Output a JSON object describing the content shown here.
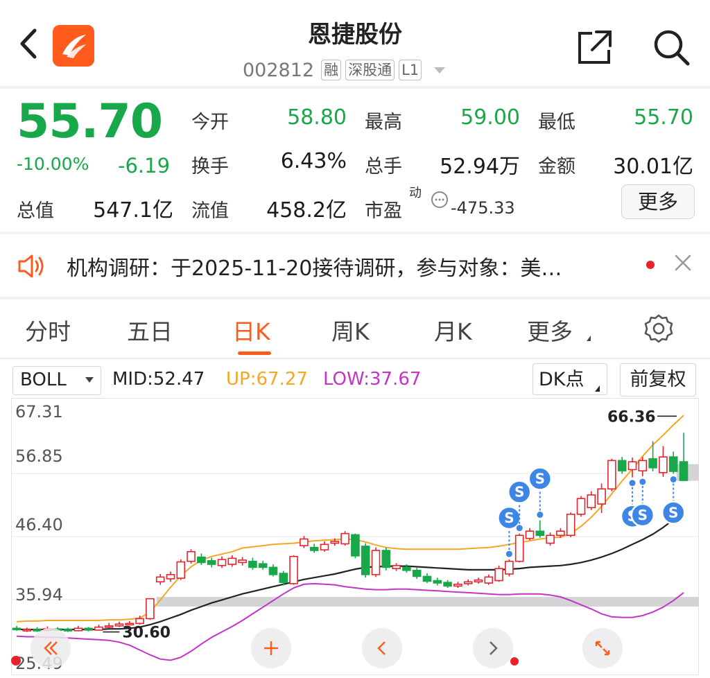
{
  "header": {
    "title": "恩捷股份",
    "code": "002812",
    "tags": [
      "融",
      "深股通",
      "L1"
    ]
  },
  "quote": {
    "price": "55.70",
    "change_pct": "-10.00%",
    "change_amt": "-6.19",
    "stats": [
      {
        "label": "今开",
        "value": "58.80",
        "green": true
      },
      {
        "label": "最高",
        "value": "59.00",
        "green": true
      },
      {
        "label": "最低",
        "value": "55.70",
        "green": true
      },
      {
        "label": "换手",
        "value": "6.43%",
        "green": false
      },
      {
        "label": "总手",
        "value": "52.94万",
        "green": false
      },
      {
        "label": "金额",
        "value": "30.01亿",
        "green": false
      },
      {
        "label": "总值",
        "value": "547.1亿",
        "green": false
      },
      {
        "label": "流值",
        "value": "458.2亿",
        "green": false
      }
    ],
    "pe_label": "市盈",
    "pe_sup": "动",
    "pe_value": "-475.33",
    "more_label": "更多"
  },
  "news": {
    "text": "机构调研：于2025-11-20接待调研，参与对象：美…"
  },
  "tabs": [
    {
      "label": "分时",
      "active": false
    },
    {
      "label": "五日",
      "active": false
    },
    {
      "label": "日K",
      "active": true
    },
    {
      "label": "周K",
      "active": false
    },
    {
      "label": "月K",
      "active": false
    },
    {
      "label": "更多",
      "active": false
    }
  ],
  "indicator": {
    "selected": "BOLL",
    "mid": "MID:52.47",
    "up": "UP:67.27",
    "low": "LOW:37.67",
    "dk_label": "DK点",
    "fq_label": "前复权"
  },
  "colors": {
    "accent": "#ff5b1c",
    "down_green": "#18a84a",
    "up_red": "#e8222b",
    "boll_up": "#f5a623",
    "boll_low": "#c433c8",
    "boll_mid": "#222222",
    "signal_blue": "#3d86e6"
  },
  "chart_data": {
    "type": "candlestick",
    "y_ticks": [
      "67.31",
      "56.85",
      "46.40",
      "35.94",
      "25.49"
    ],
    "ylim": [
      25.49,
      67.31
    ],
    "annotations": {
      "max_label": "66.36",
      "min_label": "30.60"
    },
    "candles": [
      {
        "o": 31.2,
        "c": 31.0,
        "h": 31.6,
        "l": 30.8
      },
      {
        "o": 30.8,
        "c": 31.0,
        "h": 31.3,
        "l": 30.6
      },
      {
        "o": 31.0,
        "c": 30.9,
        "h": 31.4,
        "l": 30.6
      },
      {
        "o": 30.9,
        "c": 31.1,
        "h": 31.5,
        "l": 30.7
      },
      {
        "o": 31.1,
        "c": 31.0,
        "h": 31.4,
        "l": 30.8
      },
      {
        "o": 31.0,
        "c": 30.8,
        "h": 31.3,
        "l": 30.6
      },
      {
        "o": 30.8,
        "c": 31.2,
        "h": 31.6,
        "l": 30.7
      },
      {
        "o": 31.2,
        "c": 30.9,
        "h": 31.4,
        "l": 30.7
      },
      {
        "o": 30.9,
        "c": 31.4,
        "h": 31.8,
        "l": 30.8
      },
      {
        "o": 31.4,
        "c": 31.6,
        "h": 32.1,
        "l": 31.2
      },
      {
        "o": 31.6,
        "c": 31.9,
        "h": 32.3,
        "l": 31.4
      },
      {
        "o": 31.9,
        "c": 32.0,
        "h": 32.4,
        "l": 31.7
      },
      {
        "o": 32.0,
        "c": 32.8,
        "h": 33.3,
        "l": 31.8
      },
      {
        "o": 32.8,
        "c": 36.1,
        "h": 36.1,
        "l": 32.6
      },
      {
        "o": 38.9,
        "c": 39.7,
        "h": 40.2,
        "l": 38.4
      },
      {
        "o": 39.4,
        "c": 40.1,
        "h": 40.6,
        "l": 38.9
      },
      {
        "o": 39.5,
        "c": 42.2,
        "h": 42.6,
        "l": 39.2
      },
      {
        "o": 42.3,
        "c": 43.9,
        "h": 44.3,
        "l": 41.9
      },
      {
        "o": 43.0,
        "c": 42.1,
        "h": 43.6,
        "l": 41.7
      },
      {
        "o": 42.4,
        "c": 41.8,
        "h": 42.9,
        "l": 41.3
      },
      {
        "o": 41.6,
        "c": 42.6,
        "h": 43.1,
        "l": 41.2
      },
      {
        "o": 41.8,
        "c": 42.8,
        "h": 43.3,
        "l": 41.4
      },
      {
        "o": 42.1,
        "c": 42.5,
        "h": 43.0,
        "l": 41.6
      },
      {
        "o": 42.3,
        "c": 41.3,
        "h": 42.9,
        "l": 40.9
      },
      {
        "o": 41.9,
        "c": 41.3,
        "h": 42.4,
        "l": 40.9
      },
      {
        "o": 41.3,
        "c": 40.1,
        "h": 41.8,
        "l": 39.8
      },
      {
        "o": 40.3,
        "c": 38.8,
        "h": 40.7,
        "l": 38.3
      },
      {
        "o": 38.6,
        "c": 43.1,
        "h": 43.3,
        "l": 38.4
      },
      {
        "o": 44.9,
        "c": 46.0,
        "h": 46.5,
        "l": 44.5
      },
      {
        "o": 44.6,
        "c": 44.1,
        "h": 45.2,
        "l": 43.7
      },
      {
        "o": 44.2,
        "c": 45.1,
        "h": 45.6,
        "l": 43.9
      },
      {
        "o": 45.3,
        "c": 45.6,
        "h": 46.1,
        "l": 44.9
      },
      {
        "o": 45.2,
        "c": 46.9,
        "h": 47.3,
        "l": 44.9
      },
      {
        "o": 46.7,
        "c": 43.2,
        "h": 46.9,
        "l": 42.8
      },
      {
        "o": 44.8,
        "c": 40.1,
        "h": 45.3,
        "l": 39.6
      },
      {
        "o": 40.1,
        "c": 44.1,
        "h": 44.6,
        "l": 39.7
      },
      {
        "o": 44.1,
        "c": 41.3,
        "h": 44.6,
        "l": 40.8
      },
      {
        "o": 41.1,
        "c": 41.6,
        "h": 42.0,
        "l": 40.7
      },
      {
        "o": 41.3,
        "c": 40.8,
        "h": 41.8,
        "l": 40.4
      },
      {
        "o": 40.8,
        "c": 39.8,
        "h": 41.2,
        "l": 39.4
      },
      {
        "o": 39.8,
        "c": 39.0,
        "h": 40.3,
        "l": 38.7
      },
      {
        "o": 39.1,
        "c": 38.7,
        "h": 39.6,
        "l": 38.3
      },
      {
        "o": 38.8,
        "c": 38.2,
        "h": 39.2,
        "l": 37.9
      },
      {
        "o": 38.2,
        "c": 38.5,
        "h": 38.9,
        "l": 37.9
      },
      {
        "o": 38.6,
        "c": 38.9,
        "h": 39.3,
        "l": 38.3
      },
      {
        "o": 38.9,
        "c": 39.2,
        "h": 39.6,
        "l": 38.6
      },
      {
        "o": 38.7,
        "c": 39.7,
        "h": 40.1,
        "l": 38.4
      },
      {
        "o": 39.1,
        "c": 41.1,
        "h": 41.6,
        "l": 38.9
      },
      {
        "o": 40.2,
        "c": 42.3,
        "h": 42.6,
        "l": 39.8
      },
      {
        "o": 42.3,
        "c": 46.6,
        "h": 46.9,
        "l": 42.1
      },
      {
        "o": 46.1,
        "c": 47.3,
        "h": 47.8,
        "l": 45.8
      },
      {
        "o": 47.3,
        "c": 46.6,
        "h": 49.1,
        "l": 46.2
      },
      {
        "o": 45.3,
        "c": 46.6,
        "h": 47.1,
        "l": 44.9
      },
      {
        "o": 46.6,
        "c": 47.3,
        "h": 47.8,
        "l": 46.2
      },
      {
        "o": 46.6,
        "c": 50.1,
        "h": 50.4,
        "l": 46.3
      },
      {
        "o": 50.1,
        "c": 52.7,
        "h": 53.1,
        "l": 49.7
      },
      {
        "o": 51.2,
        "c": 53.3,
        "h": 53.9,
        "l": 50.8
      },
      {
        "o": 51.8,
        "c": 54.3,
        "h": 55.2,
        "l": 50.3
      },
      {
        "o": 54.3,
        "c": 59.0,
        "h": 59.3,
        "l": 53.9
      },
      {
        "o": 59.0,
        "c": 57.3,
        "h": 59.6,
        "l": 56.8
      },
      {
        "o": 57.5,
        "c": 58.8,
        "h": 59.5,
        "l": 56.2
      },
      {
        "o": 57.3,
        "c": 59.0,
        "h": 59.6,
        "l": 56.4
      },
      {
        "o": 59.3,
        "c": 57.8,
        "h": 62.2,
        "l": 57.2
      },
      {
        "o": 57.0,
        "c": 59.6,
        "h": 61.4,
        "l": 56.3
      },
      {
        "o": 59.6,
        "c": 57.2,
        "h": 60.5,
        "l": 56.8
      },
      {
        "o": 58.8,
        "c": 55.7,
        "h": 63.6,
        "l": 55.7
      }
    ],
    "mid_line": [
      31.0,
      31.0,
      31.0,
      31.0,
      31.0,
      31.0,
      31.0,
      31.0,
      31.0,
      31.1,
      31.1,
      31.2,
      31.4,
      31.8,
      32.3,
      32.9,
      33.5,
      34.2,
      34.8,
      35.4,
      35.9,
      36.4,
      36.9,
      37.3,
      37.7,
      38.1,
      38.5,
      38.9,
      39.3,
      39.6,
      39.9,
      40.2,
      40.6,
      41.0,
      41.3,
      41.4,
      41.5,
      41.5,
      41.5,
      41.4,
      41.3,
      41.2,
      41.1,
      41.0,
      40.9,
      40.9,
      40.9,
      40.9,
      41.0,
      41.1,
      41.3,
      41.4,
      41.5,
      41.6,
      41.8,
      42.1,
      42.5,
      43.0,
      43.6,
      44.3,
      45.1,
      45.9,
      46.8,
      47.9,
      49.2,
      50.3
    ],
    "upper_line": [
      32.3,
      32.4,
      32.4,
      32.5,
      32.5,
      32.5,
      32.5,
      32.5,
      32.5,
      32.6,
      32.6,
      32.7,
      32.9,
      33.9,
      35.9,
      38.0,
      39.9,
      41.4,
      42.5,
      43.1,
      43.5,
      43.9,
      44.5,
      44.7,
      44.9,
      45.1,
      45.2,
      45.3,
      45.5,
      45.7,
      45.8,
      45.9,
      46.0,
      45.9,
      45.5,
      45.0,
      44.6,
      44.4,
      44.3,
      44.3,
      44.3,
      44.3,
      44.3,
      44.3,
      44.4,
      44.5,
      44.6,
      44.8,
      45.1,
      45.4,
      45.7,
      46.0,
      46.2,
      46.3,
      46.9,
      48.1,
      49.6,
      51.4,
      53.5,
      55.6,
      57.6,
      59.7,
      61.6,
      63.2,
      64.9,
      66.5
    ],
    "lower_line": [
      29.9,
      29.8,
      29.8,
      29.7,
      29.7,
      29.6,
      29.5,
      29.4,
      29.3,
      29.2,
      28.9,
      28.4,
      27.6,
      26.8,
      26.1,
      25.9,
      26.4,
      27.4,
      28.6,
      29.7,
      30.6,
      31.5,
      32.5,
      33.6,
      34.7,
      35.8,
      36.9,
      37.9,
      38.5,
      38.6,
      38.5,
      38.4,
      38.1,
      37.9,
      37.7,
      37.6,
      37.6,
      37.7,
      37.7,
      37.6,
      37.5,
      37.4,
      37.3,
      37.2,
      37.1,
      37.0,
      36.9,
      36.8,
      36.8,
      36.9,
      36.9,
      36.9,
      36.7,
      36.4,
      35.8,
      35.1,
      34.4,
      33.6,
      33.1,
      33.0,
      33.0,
      33.3,
      33.9,
      34.7,
      35.8,
      37.1
    ],
    "signals": [
      {
        "candle": 48,
        "side": "above",
        "label": "S"
      },
      {
        "candle": 49,
        "side": "above",
        "label": "S"
      },
      {
        "candle": 51,
        "side": "above",
        "label": "S"
      },
      {
        "candle": 60,
        "side": "below",
        "label": "S"
      },
      {
        "candle": 61,
        "side": "below",
        "label": "S"
      },
      {
        "candle": 64,
        "side": "below",
        "label": "S"
      }
    ],
    "controls": [
      "double-left",
      "plus",
      "left",
      "right",
      "expand"
    ]
  }
}
